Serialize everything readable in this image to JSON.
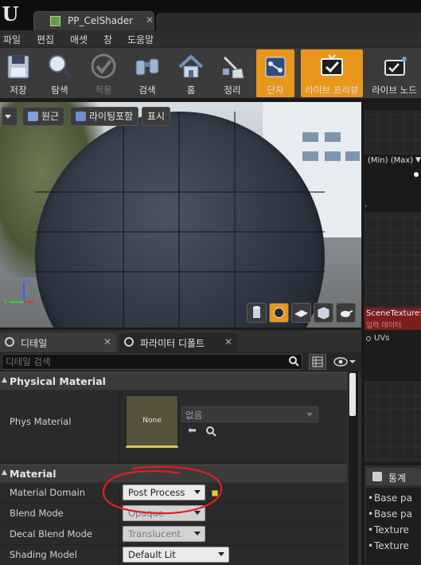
{
  "titlebar": {
    "doc_tab": "PP_CelShader",
    "logo_letter": "U"
  },
  "menu": [
    "파일",
    "편집",
    "애셋",
    "창",
    "도움말"
  ],
  "toolbar": {
    "buttons": [
      {
        "label": "저장",
        "icon": "save-icon"
      },
      {
        "label": "탐색",
        "icon": "magnifier-icon"
      },
      {
        "label": "적용",
        "icon": "check-icon"
      },
      {
        "label": "검색",
        "icon": "binoculars-icon"
      },
      {
        "label": "홈",
        "icon": "home-icon"
      },
      {
        "label": "정리",
        "icon": "broom-icon"
      },
      {
        "label": "단자",
        "icon": "pins-icon"
      },
      {
        "label": "라이브 프리뷰",
        "icon": "live-preview-icon"
      },
      {
        "label": "라이브 노드",
        "icon": "live-nodes-icon"
      }
    ],
    "accent": "#e8961c"
  },
  "viewport": {
    "buttons": {
      "perspective": "원근",
      "lit": "라이팅포함",
      "show": "표시"
    },
    "axis": {
      "x": "X",
      "y": "Y",
      "z": "Z"
    }
  },
  "graph": {
    "node1_title": "(Min) (Max)",
    "node2_title": "SceneTexture:D",
    "node2_sub": "입력 데이터",
    "node2_pin": "UVs",
    "node2_color": "#7a1e1e"
  },
  "stats": {
    "tab": "통계",
    "lines": [
      "Base pa",
      "Base pa",
      "Texture",
      "Texture"
    ]
  },
  "details": {
    "tab_details": "디테일",
    "tab_params": "파라미터 디폴트",
    "search_placeholder": "디테일 검색",
    "physical_material": {
      "header": "Physical Material",
      "prop_label": "Phys Material",
      "thumb_label": "None",
      "asset_value": "없음"
    },
    "material": {
      "header": "Material",
      "rows": [
        {
          "label": "Material Domain",
          "value": "Post Process"
        },
        {
          "label": "Blend Mode",
          "value": "Opaque"
        },
        {
          "label": "Decal Blend Mode",
          "value": "Translucent"
        },
        {
          "label": "Shading Model",
          "value": "Default Lit"
        }
      ]
    }
  }
}
